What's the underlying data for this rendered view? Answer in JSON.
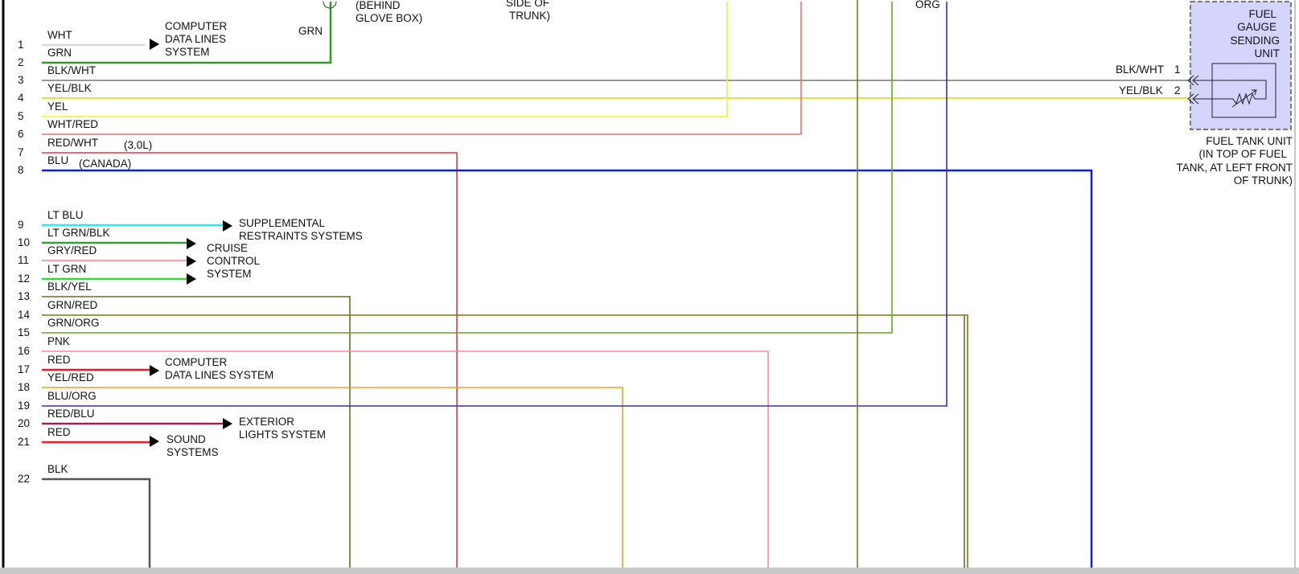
{
  "top": {
    "behind_glove_box": [
      "(BEHIND",
      "GLOVE BOX)"
    ],
    "side_of_trunk": [
      "SIDE OF",
      "TRUNK)"
    ],
    "org": "ORG",
    "grn": "GRN"
  },
  "pins": [
    {
      "num": "1",
      "wire": "WHT",
      "color": "#d9d9d9"
    },
    {
      "num": "2",
      "wire": "GRN",
      "color": "#2e9a1e"
    },
    {
      "num": "3",
      "wire": "BLK/WHT",
      "color": "#777777"
    },
    {
      "num": "4",
      "wire": "YEL/BLK",
      "color": "#d8d800"
    },
    {
      "num": "5",
      "wire": "YEL",
      "color": "#f2f22a"
    },
    {
      "num": "6",
      "wire": "WHT/RED",
      "color": "#ee7070"
    },
    {
      "num": "7",
      "wire": "RED/WHT",
      "color": "#e83838"
    },
    {
      "num": "8",
      "wire": "BLU",
      "color": "#0a1fe6"
    },
    {
      "num": "9",
      "wire": "LT BLU",
      "color": "#33e6f2"
    },
    {
      "num": "10",
      "wire": "LT GRN/BLK",
      "color": "#2ea62e"
    },
    {
      "num": "11",
      "wire": "GRY/RED",
      "color": "#f08080"
    },
    {
      "num": "12",
      "wire": "LT GRN",
      "color": "#39d639"
    },
    {
      "num": "13",
      "wire": "BLK/YEL",
      "color": "#6e6a2e"
    },
    {
      "num": "14",
      "wire": "GRN/RED",
      "color": "#7a7a1e"
    },
    {
      "num": "15",
      "wire": "GRN/ORG",
      "color": "#6aa61e"
    },
    {
      "num": "16",
      "wire": "PNK",
      "color": "#f28aa8"
    },
    {
      "num": "17",
      "wire": "RED",
      "color": "#ee1c1c"
    },
    {
      "num": "18",
      "wire": "YEL/RED",
      "color": "#e8a21e"
    },
    {
      "num": "19",
      "wire": "BLU/ORG",
      "color": "#4a2a9c"
    },
    {
      "num": "20",
      "wire": "RED/BLU",
      "color": "#a81e5a"
    },
    {
      "num": "21",
      "wire": "RED",
      "color": "#ff1a1a"
    },
    {
      "num": "22",
      "wire": "BLK",
      "color": "#555555"
    }
  ],
  "notes": {
    "engine": "(3.0L)",
    "canada": "(CANADA)"
  },
  "destinations": {
    "computer_data_lines_top": [
      "COMPUTER",
      "DATA LINES",
      "SYSTEM"
    ],
    "supplemental": [
      "SUPPLEMENTAL",
      "RESTRAINTS SYSTEMS"
    ],
    "cruise": [
      "CRUISE",
      "CONTROL",
      "SYSTEM"
    ],
    "computer_data_lines_bottom": [
      "COMPUTER",
      "DATA LINES SYSTEM"
    ],
    "exterior": [
      "EXTERIOR",
      "LIGHTS SYSTEM"
    ],
    "sound": [
      "SOUND",
      "SYSTEMS"
    ]
  },
  "fuel_tank": {
    "sender_title": [
      "FUEL",
      "GAUGE",
      "SENDING",
      "UNIT"
    ],
    "terminal_1_wire": "BLK/WHT",
    "terminal_1_num": "1",
    "terminal_2_wire": "YEL/BLK",
    "terminal_2_num": "2",
    "unit_label": [
      "FUEL TANK UNIT",
      "(IN TOP OF FUEL",
      "TANK, AT LEFT FRONT",
      "OF TRUNK)"
    ]
  },
  "colors": {
    "fuel_box_fill": "#d4d4ff",
    "frame": "#000000"
  }
}
